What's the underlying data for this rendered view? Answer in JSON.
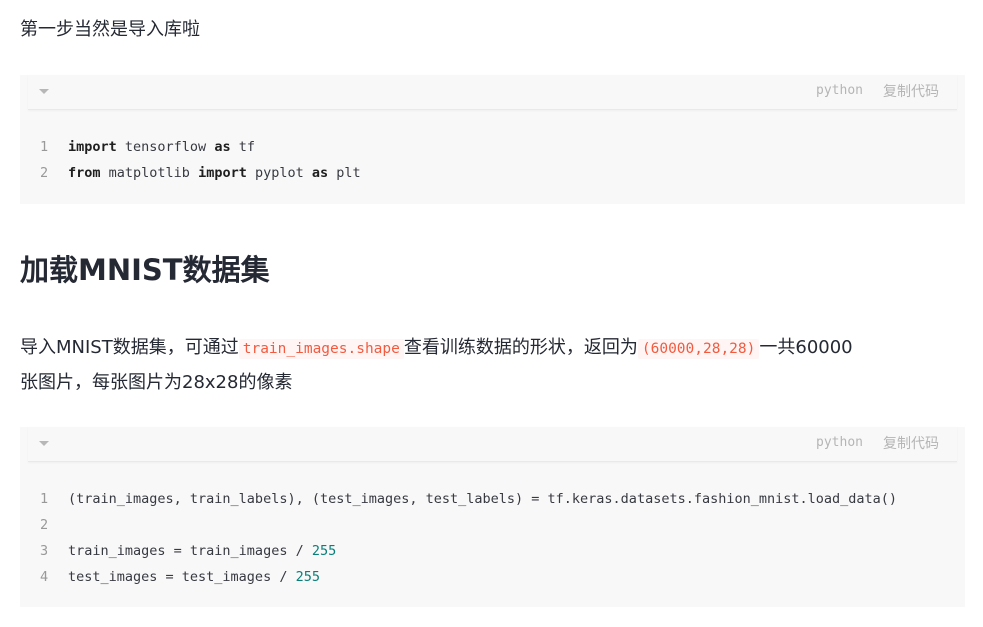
{
  "intro": {
    "text": "第一步当然是导入库啦"
  },
  "block1": {
    "lang": "python",
    "copy_label": "复制代码",
    "lines": [
      {
        "no": "1",
        "parts": [
          {
            "t": "import",
            "k": "kw"
          },
          {
            "t": " tensorflow ",
            "k": ""
          },
          {
            "t": "as",
            "k": "kw"
          },
          {
            "t": " tf",
            "k": ""
          }
        ]
      },
      {
        "no": "2",
        "parts": [
          {
            "t": "from",
            "k": "kw"
          },
          {
            "t": " matplotlib ",
            "k": ""
          },
          {
            "t": "import",
            "k": "kw"
          },
          {
            "t": " pyplot ",
            "k": ""
          },
          {
            "t": "as",
            "k": "kw"
          },
          {
            "t": " plt",
            "k": ""
          }
        ]
      }
    ]
  },
  "heading": {
    "text": "加载MNIST数据集"
  },
  "desc": {
    "part1": "导入MNIST数据集，可通过",
    "code1": "train_images.shape",
    "part2": "查看训练数据的形状，返回为",
    "code2": "(60000,28,28)",
    "part3": "一共60000",
    "line2": "张图片，每张图片为28x28的像素"
  },
  "block2": {
    "lang": "python",
    "copy_label": "复制代码",
    "lines": [
      {
        "no": "1",
        "parts": [
          {
            "t": "(train_images, train_labels), (test_images, test_labels) = tf.keras.datasets.fashion_mnist.load_data()",
            "k": ""
          }
        ]
      },
      {
        "no": "2",
        "parts": []
      },
      {
        "no": "3",
        "parts": [
          {
            "t": "train_images = train_images / ",
            "k": ""
          },
          {
            "t": "255",
            "k": "num"
          }
        ]
      },
      {
        "no": "4",
        "parts": [
          {
            "t": "test_images = test_images / ",
            "k": ""
          },
          {
            "t": "255",
            "k": "num"
          }
        ]
      }
    ]
  }
}
